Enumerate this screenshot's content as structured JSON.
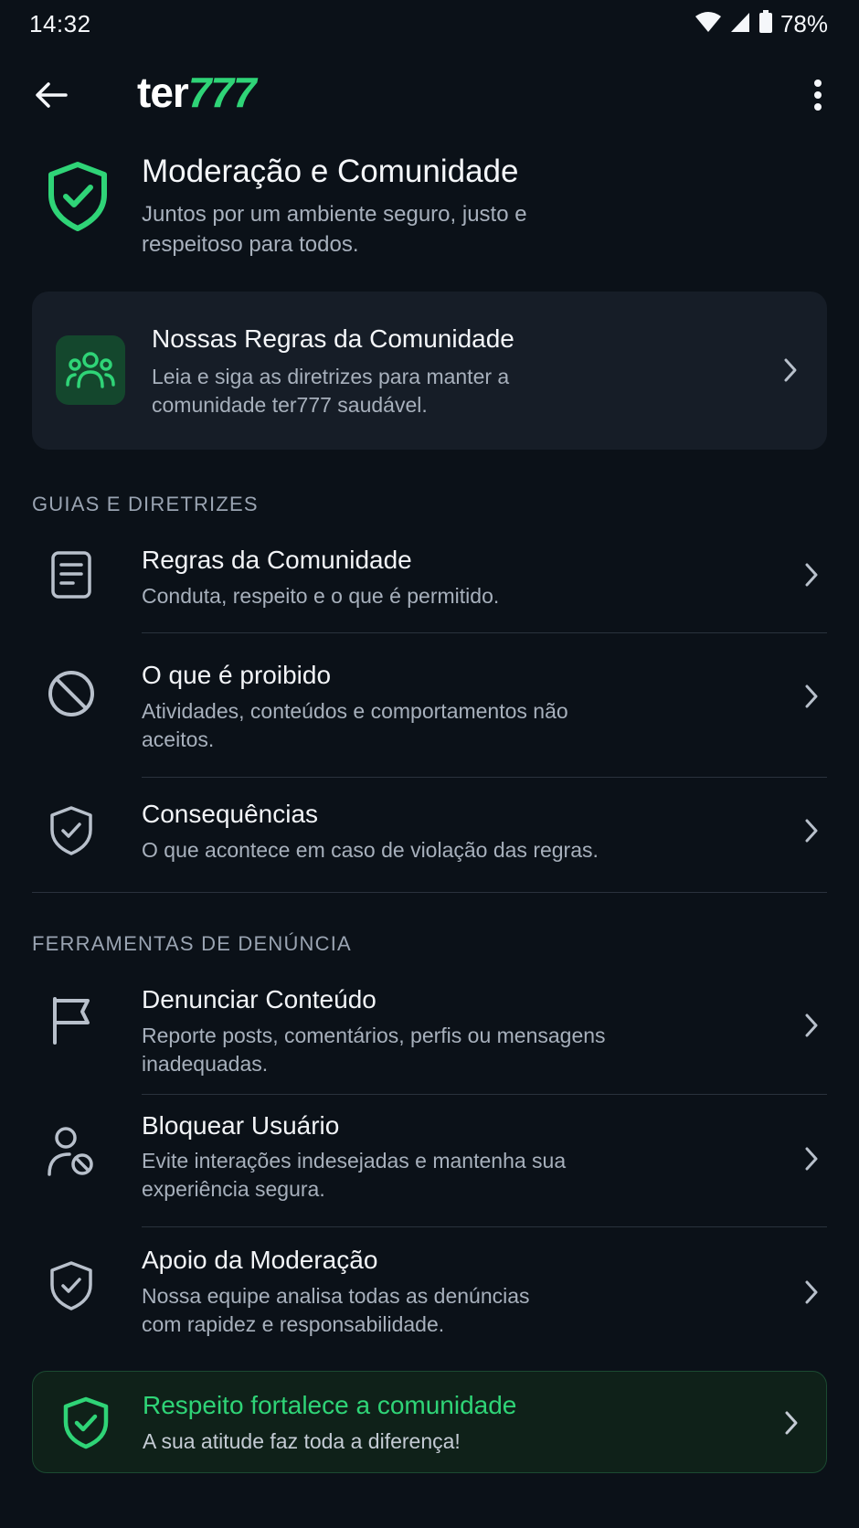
{
  "status_bar": {
    "time": "14:32",
    "battery": "78%"
  },
  "app_bar": {
    "logo_prefix": "ter",
    "logo_suffix": "777"
  },
  "hero": {
    "title": "Moderação e Comunidade",
    "subtitle": "Juntos por um ambiente seguro, justo e respeitoso para todos."
  },
  "rules_card": {
    "title": "Nossas Regras da Comunidade",
    "description": "Leia e siga as diretrizes para manter a comunidade ter777 saudável."
  },
  "sections": {
    "guides": {
      "label": "GUIAS E DIRETRIZES",
      "items": [
        {
          "icon": "document-icon",
          "title": "Regras da Comunidade",
          "description": "Conduta, respeito e o que é permitido."
        },
        {
          "icon": "prohibited-icon",
          "title": "O que é proibido",
          "description": "Atividades, conteúdos e comportamentos não aceitos."
        },
        {
          "icon": "shield-check-icon",
          "title": "Consequências",
          "description": "O que acontece em caso de violação das regras."
        }
      ]
    },
    "reporting": {
      "label": "FERRAMENTAS DE DENÚNCIA",
      "items": [
        {
          "icon": "flag-icon",
          "title": "Denunciar Conteúdo",
          "description": "Reporte posts, comentários, perfis ou mensagens inadequadas."
        },
        {
          "icon": "block-user-icon",
          "title": "Bloquear Usuário",
          "description": "Evite interações indesejadas e mantenha sua experiência segura."
        },
        {
          "icon": "shield-check-icon",
          "title": "Apoio da Moderação",
          "description": "Nossa equipe analisa todas as denúncias com rapidez e responsabilidade."
        }
      ]
    }
  },
  "banner": {
    "title": "Respeito fortalece a comunidade",
    "subtitle": "A sua atitude faz toda a diferença!"
  },
  "colors": {
    "accent": "#2fd477",
    "background": "#0b1118",
    "card": "#161d27"
  }
}
